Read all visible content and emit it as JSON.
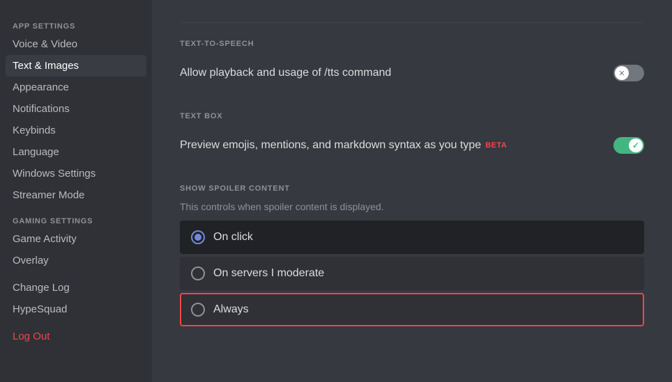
{
  "sidebar": {
    "app_settings_label": "APP SETTINGS",
    "gaming_settings_label": "GAMING SETTINGS",
    "items_app": [
      {
        "id": "voice-video",
        "label": "Voice & Video",
        "active": false
      },
      {
        "id": "text-images",
        "label": "Text & Images",
        "active": true
      },
      {
        "id": "appearance",
        "label": "Appearance",
        "active": false
      },
      {
        "id": "notifications",
        "label": "Notifications",
        "active": false
      },
      {
        "id": "keybinds",
        "label": "Keybinds",
        "active": false
      },
      {
        "id": "language",
        "label": "Language",
        "active": false
      },
      {
        "id": "windows-settings",
        "label": "Windows Settings",
        "active": false
      },
      {
        "id": "streamer-mode",
        "label": "Streamer Mode",
        "active": false
      }
    ],
    "items_gaming": [
      {
        "id": "game-activity",
        "label": "Game Activity",
        "active": false
      },
      {
        "id": "overlay",
        "label": "Overlay",
        "active": false
      }
    ],
    "items_misc": [
      {
        "id": "change-log",
        "label": "Change Log",
        "active": false
      },
      {
        "id": "hypesquad",
        "label": "HypeSquad",
        "active": false
      }
    ],
    "logout_label": "Log Out"
  },
  "main": {
    "tts_section_label": "TEXT-TO-SPEECH",
    "tts_setting_label": "Allow playback and usage of /tts command",
    "tts_toggle_state": "off",
    "textbox_section_label": "TEXT BOX",
    "textbox_setting_label": "Preview emojis, mentions, and markdown syntax as you type",
    "beta_label": "BETA",
    "textbox_toggle_state": "on",
    "spoiler_section_label": "SHOW SPOILER CONTENT",
    "spoiler_desc": "This controls when spoiler content is displayed.",
    "spoiler_options": [
      {
        "id": "on-click",
        "label": "On click",
        "selected": true,
        "highlighted": false
      },
      {
        "id": "on-servers",
        "label": "On servers I moderate",
        "selected": false,
        "highlighted": false
      },
      {
        "id": "always",
        "label": "Always",
        "selected": false,
        "highlighted": true
      }
    ]
  }
}
